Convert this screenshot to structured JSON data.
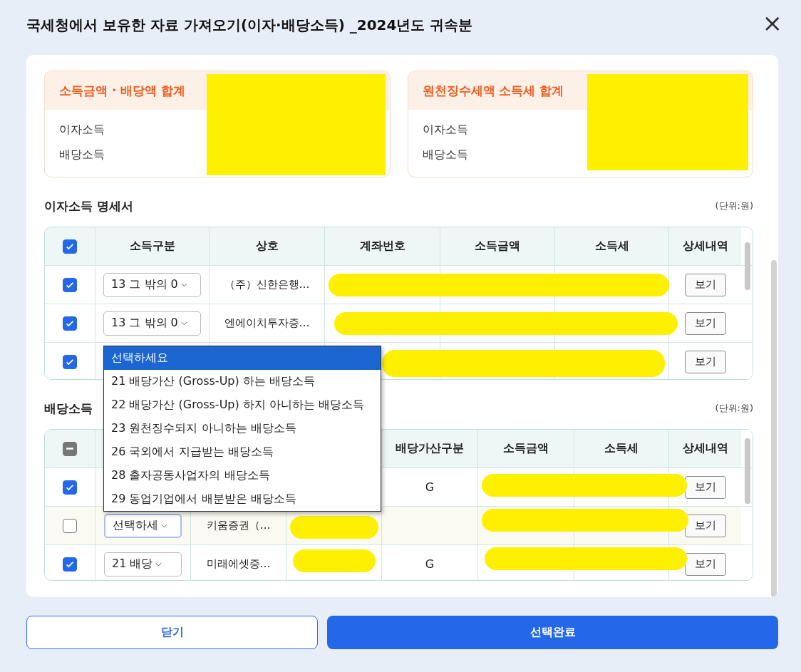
{
  "dialog": {
    "title": "국세청에서 보유한 자료 가져오기(이자·배당소득) _2024년도 귀속분",
    "close": "×"
  },
  "summary": [
    {
      "title": "소득금액 · 배당액 합계",
      "rows": [
        "이자소득",
        "배당소득"
      ]
    },
    {
      "title": "원천징수세액 소득세 합계",
      "rows": [
        "이자소득",
        "배당소득"
      ]
    }
  ],
  "interest": {
    "title": "이자소득 명세서",
    "unit": "(단위:원)",
    "header_checked": true,
    "columns": [
      "소득구분",
      "상호",
      "계좌번호",
      "소득금액",
      "소득세",
      "상세내역"
    ],
    "rows": [
      {
        "checked": true,
        "income_type": "13 그 밖의 0",
        "company": "（주）신한은행…",
        "action": "보기"
      },
      {
        "checked": true,
        "income_type": "13 그 밖의 0",
        "company": "엔에이치투자증…",
        "action": "보기"
      },
      {
        "checked": true,
        "action": "보기"
      }
    ]
  },
  "dividend": {
    "title": "배당소득",
    "unit": "(단위:원)",
    "header_indeterminate": true,
    "columns": [
      "배당가산구분",
      "소득금액",
      "소득세",
      "상세내역"
    ],
    "rows": [
      {
        "checked": true,
        "focused": false,
        "gross_up": "G",
        "action": "보기"
      },
      {
        "checked": false,
        "focused": true,
        "income_type": "선택하세",
        "company": "키움증권（…",
        "action": "보기"
      },
      {
        "checked": true,
        "focused": false,
        "income_type": "21 배당",
        "company": "미래에셋증…",
        "gross_up": "G",
        "action": "보기"
      }
    ]
  },
  "dropdown": {
    "options": [
      {
        "label": "선택하세요",
        "selected": true
      },
      {
        "label": "21 배당가산 (Gross-Up) 하는 배당소득",
        "selected": false
      },
      {
        "label": "22 배당가산 (Gross-Up) 하지 아니하는 배당소득",
        "selected": false
      },
      {
        "label": "23 원천징수되지 아니하는 배당소득",
        "selected": false
      },
      {
        "label": "26 국외에서 지급받는 배당소득",
        "selected": false
      },
      {
        "label": "28 출자공동사업자의 배당소득",
        "selected": false
      },
      {
        "label": "29 동업기업에서 배분받은 배당소득",
        "selected": false
      }
    ]
  },
  "buttons": [
    {
      "label": "닫기",
      "kind": "secondary"
    },
    {
      "label": "선택완료",
      "kind": "primary"
    }
  ]
}
